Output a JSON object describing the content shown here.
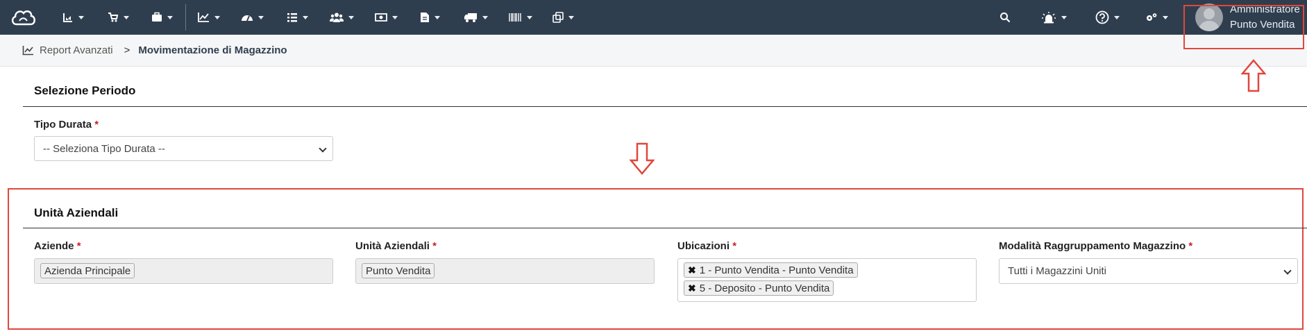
{
  "navbar": {
    "items": [
      {
        "icon": "cloud-logo-icon"
      },
      {
        "icon": "chart-pie-icon"
      },
      {
        "icon": "cart-icon"
      },
      {
        "icon": "briefcase-icon"
      },
      {
        "icon": "line-chart-icon"
      },
      {
        "icon": "dashboard-icon"
      },
      {
        "icon": "list-icon"
      },
      {
        "icon": "users-icon"
      },
      {
        "icon": "money-icon"
      },
      {
        "icon": "document-icon"
      },
      {
        "icon": "truck-icon"
      },
      {
        "icon": "barcode-icon"
      },
      {
        "icon": "clone-icon"
      }
    ],
    "right": [
      {
        "icon": "search-icon"
      },
      {
        "icon": "alarm-icon"
      },
      {
        "icon": "help-icon"
      },
      {
        "icon": "gears-icon"
      }
    ],
    "user": {
      "name": "Amministratore",
      "store": "Punto Vendita"
    }
  },
  "breadcrumb": {
    "parent": "Report Avanzati",
    "separator": ">",
    "current": "Movimentazione di Magazzino"
  },
  "period_section": {
    "title": "Selezione Periodo",
    "duration_label": "Tipo Durata",
    "duration_value": "-- Seleziona Tipo Durata --"
  },
  "units_section": {
    "title": "Unità Aziendali",
    "companies_label": "Aziende",
    "companies_tags": [
      "Azienda Principale"
    ],
    "units_label": "Unità Aziendali",
    "units_tags": [
      "Punto Vendita"
    ],
    "locations_label": "Ubicazioni",
    "locations_tags": [
      "1 - Punto Vendita - Punto Vendita",
      "5 - Deposito - Punto Vendita"
    ],
    "grouping_label": "Modalità Raggruppamento Magazzino",
    "grouping_value": "Tutti i Magazzini Uniti"
  },
  "required_marker": "*",
  "tag_remove": "✖",
  "colors": {
    "navbar": "#2f3e4f",
    "annotation": "#e0473c",
    "required": "#cc1f1f"
  }
}
